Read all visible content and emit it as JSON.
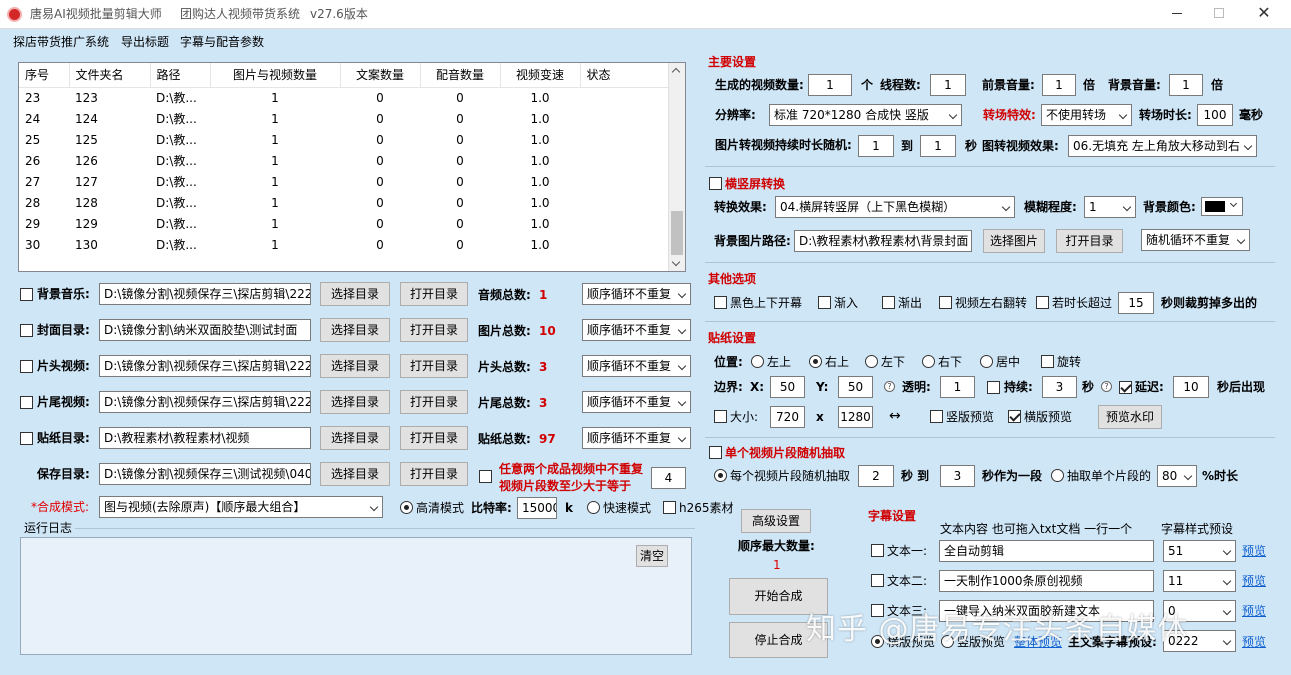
{
  "window": {
    "app_name": "唐易AI视频批量剪辑大师",
    "subtitle": "团购达人视频带货系统",
    "version": "v27.6版本"
  },
  "menu": [
    "探店带货推广系统",
    "导出标题",
    "字幕与配音参数"
  ],
  "table": {
    "headers": [
      "序号",
      "文件夹名",
      "路径",
      "图片与视频数量",
      "文案数量",
      "配音数量",
      "视频变速",
      "状态"
    ],
    "rows": [
      [
        "23",
        "123",
        "D:\\教...",
        "1",
        "0",
        "0",
        "1.0",
        ""
      ],
      [
        "24",
        "124",
        "D:\\教...",
        "1",
        "0",
        "0",
        "1.0",
        ""
      ],
      [
        "25",
        "125",
        "D:\\教...",
        "1",
        "0",
        "0",
        "1.0",
        ""
      ],
      [
        "26",
        "126",
        "D:\\教...",
        "1",
        "0",
        "0",
        "1.0",
        ""
      ],
      [
        "27",
        "127",
        "D:\\教...",
        "1",
        "0",
        "0",
        "1.0",
        ""
      ],
      [
        "28",
        "128",
        "D:\\教...",
        "1",
        "0",
        "0",
        "1.0",
        ""
      ],
      [
        "29",
        "129",
        "D:\\教...",
        "1",
        "0",
        "0",
        "1.0",
        ""
      ],
      [
        "30",
        "130",
        "D:\\教...",
        "1",
        "0",
        "0",
        "1.0",
        ""
      ]
    ]
  },
  "dirs": [
    {
      "label": "背景音乐:",
      "path": "D:\\镜像分割\\视频保存三\\探店剪辑\\222",
      "count_label": "音频总数:",
      "count": "1",
      "order": "顺序循环不重复"
    },
    {
      "label": "封面目录:",
      "path": "D:\\镜像分割\\纳米双面胶垫\\测试封面",
      "count_label": "图片总数:",
      "count": "10",
      "order": "顺序循环不重复"
    },
    {
      "label": "片头视频:",
      "path": "D:\\镜像分割\\视频保存三\\探店剪辑\\222",
      "count_label": "片头总数:",
      "count": "3",
      "order": "顺序循环不重复"
    },
    {
      "label": "片尾视频:",
      "path": "D:\\镜像分割\\视频保存三\\探店剪辑\\222",
      "count_label": "片尾总数:",
      "count": "3",
      "order": "顺序循环不重复"
    },
    {
      "label": "贴纸目录:",
      "path": "D:\\教程素材\\教程素材\\视频",
      "count_label": "贴纸总数:",
      "count": "97",
      "order": "顺序循环不重复"
    }
  ],
  "save": {
    "label": "保存目录:",
    "path": "D:\\镜像分割\\视频保存三\\测试视频\\040",
    "choose": "选择目录",
    "open": "打开目录",
    "note_line1": "任意两个成品视频中不重复",
    "note_line2": "视频片段数至少大于等于",
    "min_value": "4"
  },
  "buttons": {
    "choose_dir": "选择目录",
    "open_dir": "打开目录",
    "clear": "清空"
  },
  "mode": {
    "label": "*合成模式:",
    "value": "图与视频(去除原声)【顺序最大组合】",
    "hd": "高清模式",
    "bitrate_label": "比特率:",
    "bitrate": "15000",
    "unit": "k",
    "fast": "快速模式",
    "h265": "h265素材"
  },
  "log": {
    "label": "运行日志"
  },
  "main_settings": {
    "title": "主要设置",
    "video_count_label": "生成的视频数量:",
    "video_count": "1",
    "unit_ge": "个",
    "threads_label": "线程数:",
    "threads": "1",
    "fg_volume_label": "前景音量:",
    "fg_volume": "1",
    "times1": "倍",
    "bg_volume_label": "背景音量:",
    "bg_volume": "1",
    "times2": "倍",
    "resolution_label": "分辨率:",
    "resolution": "标准 720*1280 合成快 竖版",
    "transition_label": "转场特效:",
    "transition": "不使用转场",
    "transition_time_label": "转场时长:",
    "transition_time": "100",
    "ms": "毫秒",
    "img_dur_label": "图片转视频持续时长随机:",
    "img_dur_from": "1",
    "to": "到",
    "img_dur_to": "1",
    "sec": "秒",
    "img_effect_label": "图转视频效果:",
    "img_effect": "06.无填充 左上角放大移动到右"
  },
  "orientation": {
    "title": "横竖屏转换",
    "effect_label": "转换效果:",
    "effect": "04.横屏转竖屏（上下黑色模糊）",
    "blur_label": "模糊程度:",
    "blur": "1",
    "bgcolor_label": "背景颜色:",
    "bgcolor": "#000000",
    "bgimg_label": "背景图片路径:",
    "bgimg_path": "D:\\教程素材\\教程素材\\背景封面",
    "choose_img": "选择图片",
    "open_dir": "打开目录",
    "order": "随机循环不重复"
  },
  "other": {
    "title": "其他选项",
    "black_bars": "黑色上下开幕",
    "fade_in": "渐入",
    "fade_out": "渐出",
    "flip": "视频左右翻转",
    "trim_label": "若时长超过",
    "trim_value": "15",
    "trim_suffix": "秒则裁剪掉多出的"
  },
  "sticker": {
    "title": "贴纸设置",
    "pos_label": "位置:",
    "positions": [
      "左上",
      "右上",
      "左下",
      "右下",
      "居中"
    ],
    "rotate": "旋转",
    "margin_label": "边界:",
    "x_label": "X:",
    "x": "50",
    "y_label": "Y:",
    "y": "50",
    "opacity_label": "透明:",
    "opacity": "1",
    "duration_label": "持续:",
    "duration": "3",
    "sec": "秒",
    "delay_label": "延迟:",
    "delay": "10",
    "delay_suffix": "秒后出现",
    "size_label": "大小:",
    "w": "720",
    "times": "x",
    "h": "1280",
    "swap": "↔",
    "vertical_preview": "竖版预览",
    "horizontal_preview": "横版预览",
    "preview_btn": "预览水印"
  },
  "segment": {
    "title": "单个视频片段随机抽取",
    "each_label": "每个视频片段随机抽取",
    "from": "2",
    "to_label": "秒 到",
    "to": "3",
    "suffix": "秒作为一段",
    "single_label": "抽取单个片段的",
    "percent": "80",
    "percent_suffix": "%时长"
  },
  "advanced": {
    "btn": "高级设置",
    "max_label": "顺序最大数量:",
    "max_value": "1",
    "start": "开始合成",
    "stop": "停止合成"
  },
  "subtitle": {
    "title": "字幕设置",
    "content_header": "文本内容 也可拖入txt文档 一行一个",
    "style_header": "字幕样式预设",
    "rows": [
      {
        "label": "文本一:",
        "text": "全自动剪辑",
        "style": "51",
        "preview": "预览"
      },
      {
        "label": "文本二:",
        "text": "一天制作1000条原创视频",
        "style": "11",
        "preview": "预览"
      },
      {
        "label": "文本三:",
        "text": "一键导入纳米双面胶新建文本",
        "style": "0",
        "preview": "预览"
      }
    ],
    "horizontal_preview": "横版预览",
    "vertical_preview": "竖版预览",
    "full_preview": "整体预览",
    "main_preset_label": "主文案字幕预设:",
    "main_preset": "0222",
    "main_preview": "预览"
  },
  "watermark": "知乎 @唐易专注头条自媒体"
}
